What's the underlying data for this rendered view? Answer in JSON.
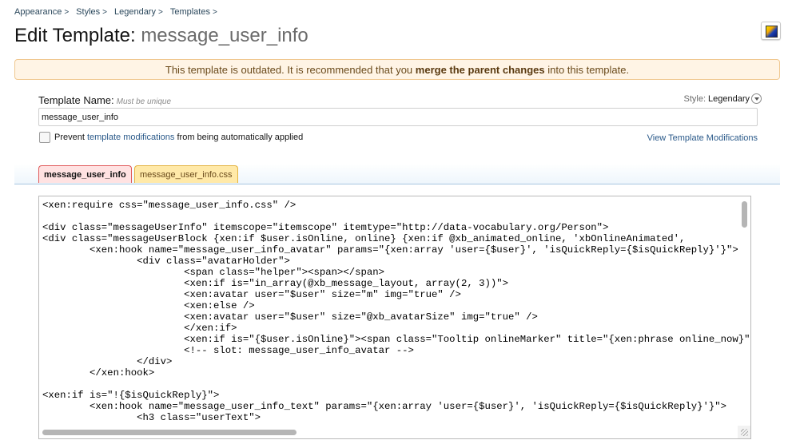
{
  "breadcrumb": [
    {
      "label": "Appearance",
      "sep": ">"
    },
    {
      "label": "Styles",
      "sep": ">"
    },
    {
      "label": "Legendary",
      "sep": ">"
    },
    {
      "label": "Templates",
      "sep": ">"
    }
  ],
  "title": {
    "prefix": "Edit Template:",
    "name": "message_user_info"
  },
  "notice": {
    "before": "This template is outdated. It is recommended that you ",
    "bold": "merge the parent changes",
    "after": " into this template."
  },
  "form": {
    "label": "Template Name:",
    "hint": "Must be unique",
    "value": "message_user_info",
    "style_label": "Style:",
    "style_value": "Legendary",
    "prevent_prefix": "Prevent ",
    "prevent_link": "template modifications",
    "prevent_suffix": " from being automatically applied",
    "view_mods": "View Template Modifications"
  },
  "tabs": [
    {
      "label": "message_user_info",
      "active": true
    },
    {
      "label": "message_user_info.css",
      "active": false
    }
  ],
  "editor": {
    "code": "<xen:require css=\"message_user_info.css\" />\n\n<div class=\"messageUserInfo\" itemscope=\"itemscope\" itemtype=\"http://data-vocabulary.org/Person\">\n<div class=\"messageUserBlock {xen:if $user.isOnline, online} {xen:if @xb_animated_online, 'xbOnlineAnimated', \n\t<xen:hook name=\"message_user_info_avatar\" params=\"{xen:array 'user={$user}', 'isQuickReply={$isQuickReply}'}\">\n\t\t<div class=\"avatarHolder\">\n\t\t\t<span class=\"helper\"><span></span>\n\t\t\t<xen:if is=\"in_array(@xb_message_layout, array(2, 3))\">\n\t\t\t<xen:avatar user=\"$user\" size=\"m\" img=\"true\" />\n\t\t\t<xen:else />\n\t\t\t<xen:avatar user=\"$user\" size=\"@xb_avatarSize\" img=\"true\" />\n\t\t\t</xen:if>\n\t\t\t<xen:if is=\"{$user.isOnline}\"><span class=\"Tooltip onlineMarker\" title=\"{xen:phrase online_now}\"></span></xen:if>\n\t\t\t<!-- slot: message_user_info_avatar -->\n\t\t</div>\n\t</xen:hook>\n\n<xen:if is=\"!{$isQuickReply}\">\n\t<xen:hook name=\"message_user_info_text\" params=\"{xen:array 'user={$user}', 'isQuickReply={$isQuickReply}'}\">\n\t\t<h3 class=\"userText\">"
  }
}
